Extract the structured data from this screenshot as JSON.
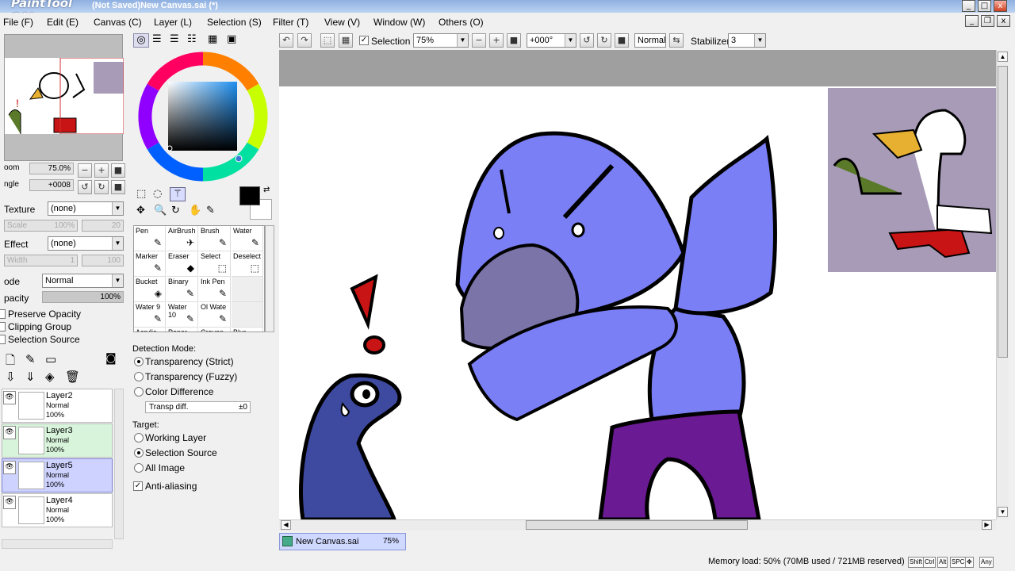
{
  "window": {
    "logo": "PaintTool SAI",
    "title": "(Not Saved)New Canvas.sai (*)",
    "minimize": "_",
    "maximize": "□",
    "close": "x"
  },
  "menu": [
    "File (F)",
    "Edit (E)",
    "Canvas (C)",
    "Layer (L)",
    "Selection (S)",
    "Filter (T)",
    "View (V)",
    "Window (W)",
    "Others (O)"
  ],
  "toolbar": {
    "selection_label": "Selection",
    "selection_checked": true,
    "zoom": "75%",
    "rotation": "+000°",
    "blend_mode": "Normal",
    "stabilizer_label": "Stabilizer",
    "stabilizer_value": "3"
  },
  "navigator": {
    "zoom_label": "oom",
    "zoom_value": "75.0%",
    "angle_label": "ngle",
    "angle_value": "+0008"
  },
  "left": {
    "texture_label": "Texture",
    "texture_value": "(none)",
    "texture_scale_label": "Scale",
    "texture_scale_value": "100%",
    "texture_scale_max": "20",
    "effect_label": "Effect",
    "effect_value": "(none)",
    "effect_width_label": "Width",
    "effect_width_value": "1",
    "effect_width_max": "100",
    "mode_label": "ode",
    "mode_value": "Normal",
    "opacity_label": "pacity",
    "opacity_value": "100%",
    "preserve_opacity": "Preserve Opacity",
    "clipping_group": "Clipping Group",
    "selection_source": "Selection Source"
  },
  "layers": [
    {
      "name": "Layer2",
      "mode": "Normal",
      "opacity": "100%",
      "bg": "#ffffff"
    },
    {
      "name": "Layer3",
      "mode": "Normal",
      "opacity": "100%",
      "bg": "#d8f5dc"
    },
    {
      "name": "Layer5",
      "mode": "Normal",
      "opacity": "100%",
      "bg": "#cdd2ff"
    },
    {
      "name": "Layer4",
      "mode": "Normal",
      "opacity": "100%",
      "bg": "#ffffff"
    }
  ],
  "tools": [
    {
      "label": "Pen",
      "icon": "✎"
    },
    {
      "label": "AirBrush",
      "icon": "✈"
    },
    {
      "label": "Brush",
      "icon": "✎"
    },
    {
      "label": "Water",
      "icon": "✎"
    },
    {
      "label": "Marker",
      "icon": "✎"
    },
    {
      "label": "Eraser",
      "icon": "◆"
    },
    {
      "label": "Select",
      "icon": "⬚"
    },
    {
      "label": "Deselect",
      "icon": "⬚"
    },
    {
      "label": "Bucket",
      "icon": "◈"
    },
    {
      "label": "Binary",
      "icon": "✎"
    },
    {
      "label": "Ink Pen",
      "icon": "✎"
    },
    {
      "label": "",
      "icon": ""
    },
    {
      "label": "Water 9",
      "icon": "✎"
    },
    {
      "label": "Water 10",
      "icon": "✎"
    },
    {
      "label": "Ol Wate",
      "icon": "✎"
    },
    {
      "label": "",
      "icon": ""
    },
    {
      "label": "Acrylic",
      "icon": ""
    },
    {
      "label": "Paper",
      "icon": ""
    },
    {
      "label": "Crayon",
      "icon": ""
    },
    {
      "label": "Blur",
      "icon": ""
    }
  ],
  "selection_tool": {
    "detection_mode_label": "Detection Mode:",
    "transparency_strict": "Transparency (Strict)",
    "transparency_fuzzy": "Transparency (Fuzzy)",
    "color_difference": "Color Difference",
    "transp_diff_label": "Transp diff.",
    "transp_diff_value": "±0",
    "target_label": "Target:",
    "working_layer": "Working Layer",
    "selection_source": "Selection Source",
    "all_image": "All Image",
    "anti_aliasing": "Anti-aliasing"
  },
  "canvas_tab": {
    "name": "New Canvas.sai",
    "zoom": "75%"
  },
  "status": {
    "memory": "Memory load: 50% (70MB used / 721MB reserved)",
    "keys": [
      "Shift",
      "Ctrl",
      "Alt",
      "SPC",
      "✥",
      "Any"
    ]
  },
  "colors": {
    "duck_blue": "#7b7ff5",
    "beak": "#7b74a8",
    "pants": "#6a1a92",
    "snake": "#3e4aa0",
    "exclaim": "#c81414",
    "ref_bg": "#a89bb8"
  }
}
